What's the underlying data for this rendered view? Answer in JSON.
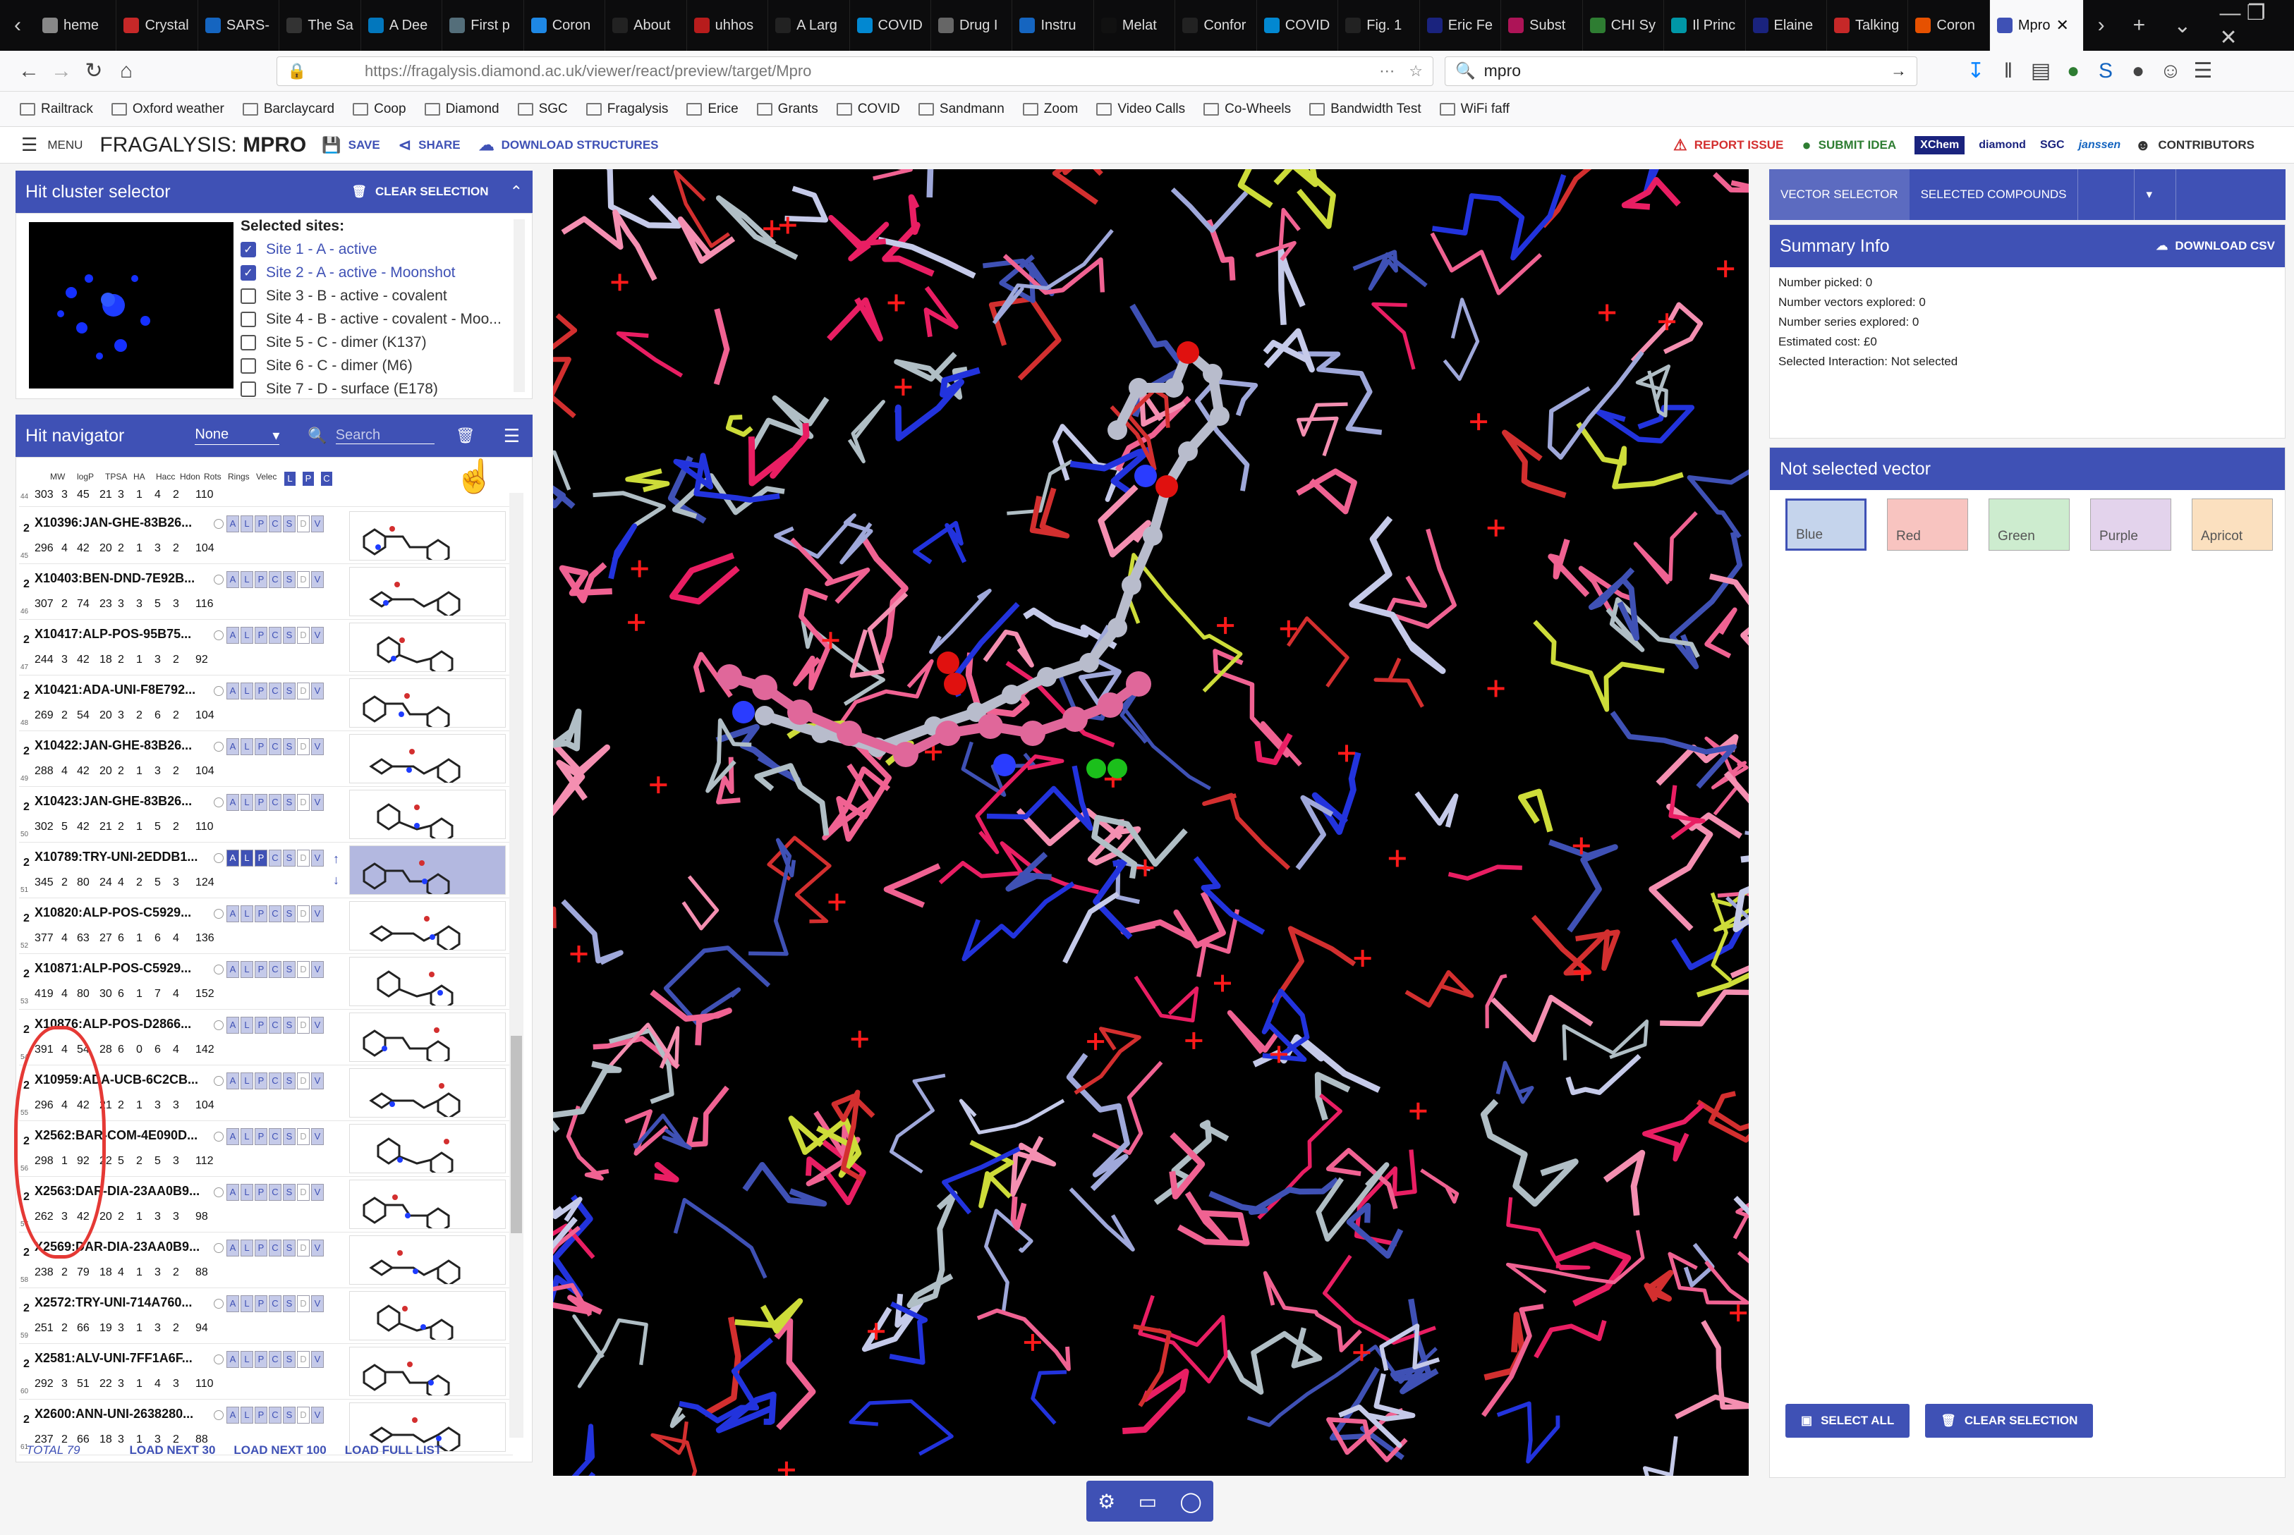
{
  "browser": {
    "tabs": [
      "heme",
      "Crystal",
      "SARS-",
      "The Sa",
      "A Dee",
      "First p",
      "Coron",
      "About",
      "uhhos",
      "A Larg",
      "COVID",
      "Drug I",
      "Instru",
      "Melat",
      "Confor",
      "COVID",
      "Fig. 1",
      "Eric Fe",
      "Subst",
      "CHI Sy",
      "Il Princ",
      "Elaine",
      "Talking",
      "Coron",
      "Mpro"
    ],
    "url": "https://fragalysis.diamond.ac.uk/viewer/react/preview/target/Mpro",
    "search": "mpro",
    "bookmarks": [
      "Railtrack",
      "Oxford weather",
      "Barclaycard",
      "Coop",
      "Diamond",
      "SGC",
      "Fragalysis",
      "Erice",
      "Grants",
      "COVID",
      "Sandmann",
      "Zoom",
      "Video Calls",
      "Co-Wheels",
      "Bandwidth Test",
      "WiFi faff"
    ]
  },
  "header": {
    "menu_label": "MENU",
    "title_prefix": "FRAGALYSIS: ",
    "title_target": "MPRO",
    "save": "SAVE",
    "share": "SHARE",
    "download": "DOWNLOAD STRUCTURES",
    "report": "REPORT ISSUE",
    "submit": "SUBMIT IDEA",
    "logos": [
      "diamond",
      "SGC",
      "janssen"
    ],
    "contributors": "CONTRIBUTORS"
  },
  "cluster": {
    "title": "Hit cluster selector",
    "clear": "CLEAR SELECTION",
    "selected_label": "Selected sites:",
    "sites": [
      {
        "label": "Site 1 - A - active",
        "checked": true
      },
      {
        "label": "Site 2 - A - active - Moonshot",
        "checked": true
      },
      {
        "label": "Site 3 - B - active - covalent",
        "checked": false
      },
      {
        "label": "Site 4 - B - active - covalent - Moo...",
        "checked": false
      },
      {
        "label": "Site 5 - C - dimer (K137)",
        "checked": false
      },
      {
        "label": "Site 6 - C - dimer (M6)",
        "checked": false
      },
      {
        "label": "Site 7 - D - surface (E178)",
        "checked": false
      }
    ]
  },
  "navigator": {
    "title": "Hit navigator",
    "filter": "None",
    "search_placeholder": "Search",
    "columns": [
      "MW",
      "logP",
      "TPSA",
      "HA",
      "Hacc",
      "Hdon",
      "Rots",
      "Rings",
      "Velec"
    ],
    "lpc": [
      "L",
      "P",
      "C"
    ],
    "partial_row": {
      "index": "44",
      "props": [
        "303",
        "3",
        "45",
        "21",
        "3",
        "1",
        "4",
        "2",
        "110"
      ]
    },
    "rows": [
      {
        "index": "45",
        "name": "X10396:JAN-GHE-83B26...",
        "props": [
          "296",
          "4",
          "42",
          "20",
          "2",
          "1",
          "3",
          "2",
          "104"
        ]
      },
      {
        "index": "46",
        "name": "X10403:BEN-DND-7E92B...",
        "props": [
          "307",
          "2",
          "74",
          "23",
          "3",
          "3",
          "5",
          "3",
          "116"
        ]
      },
      {
        "index": "47",
        "name": "X10417:ALP-POS-95B75...",
        "props": [
          "244",
          "3",
          "42",
          "18",
          "2",
          "1",
          "3",
          "2",
          "92"
        ]
      },
      {
        "index": "48",
        "name": "X10421:ADA-UNI-F8E792...",
        "props": [
          "269",
          "2",
          "54",
          "20",
          "3",
          "2",
          "6",
          "2",
          "104"
        ]
      },
      {
        "index": "49",
        "name": "X10422:JAN-GHE-83B26...",
        "props": [
          "288",
          "4",
          "42",
          "20",
          "2",
          "1",
          "3",
          "2",
          "104"
        ]
      },
      {
        "index": "50",
        "name": "X10423:JAN-GHE-83B26...",
        "props": [
          "302",
          "5",
          "42",
          "21",
          "2",
          "1",
          "5",
          "2",
          "110"
        ]
      },
      {
        "index": "51",
        "name": "X10789:TRY-UNI-2EDDB1...",
        "props": [
          "345",
          "2",
          "80",
          "24",
          "4",
          "2",
          "5",
          "3",
          "124"
        ],
        "selected": true
      },
      {
        "index": "52",
        "name": "X10820:ALP-POS-C5929...",
        "props": [
          "377",
          "4",
          "63",
          "27",
          "6",
          "1",
          "6",
          "4",
          "136"
        ]
      },
      {
        "index": "53",
        "name": "X10871:ALP-POS-C5929...",
        "props": [
          "419",
          "4",
          "80",
          "30",
          "6",
          "1",
          "7",
          "4",
          "152"
        ]
      },
      {
        "index": "54",
        "name": "X10876:ALP-POS-D2866...",
        "props": [
          "391",
          "4",
          "54",
          "28",
          "6",
          "0",
          "6",
          "4",
          "142"
        ]
      },
      {
        "index": "55",
        "name": "X10959:ADA-UCB-6C2CB...",
        "props": [
          "296",
          "4",
          "42",
          "21",
          "2",
          "1",
          "3",
          "3",
          "104"
        ]
      },
      {
        "index": "56",
        "name": "X2562:BAR-COM-4E090D...",
        "props": [
          "298",
          "1",
          "92",
          "22",
          "5",
          "2",
          "5",
          "3",
          "112"
        ]
      },
      {
        "index": "57",
        "name": "X2563:DAR-DIA-23AA0B9...",
        "props": [
          "262",
          "3",
          "42",
          "20",
          "2",
          "1",
          "3",
          "3",
          "98"
        ]
      },
      {
        "index": "58",
        "name": "X2569:DAR-DIA-23AA0B9...",
        "props": [
          "238",
          "2",
          "79",
          "18",
          "4",
          "1",
          "3",
          "2",
          "88"
        ]
      },
      {
        "index": "59",
        "name": "X2572:TRY-UNI-714A760...",
        "props": [
          "251",
          "2",
          "66",
          "19",
          "3",
          "1",
          "3",
          "2",
          "94"
        ]
      },
      {
        "index": "60",
        "name": "X2581:ALV-UNI-7FF1A6F...",
        "props": [
          "292",
          "3",
          "51",
          "22",
          "3",
          "1",
          "4",
          "3",
          "110"
        ]
      },
      {
        "index": "61",
        "name": "X2600:ANN-UNI-2638280...",
        "props": [
          "237",
          "2",
          "66",
          "18",
          "3",
          "1",
          "3",
          "2",
          "88"
        ]
      }
    ],
    "total": "TOTAL 79",
    "load_30": "LOAD NEXT 30",
    "load_100": "LOAD NEXT 100",
    "load_full": "LOAD FULL LIST"
  },
  "right": {
    "tab1": "VECTOR SELECTOR",
    "tab2": "SELECTED COMPOUNDS",
    "summary_title": "Summary Info",
    "download_csv": "DOWNLOAD CSV",
    "summary_lines": [
      "Number picked: 0",
      "Number vectors explored: 0",
      "Number series explored: 0",
      "Estimated cost: £0",
      "Selected Interaction: Not selected"
    ],
    "nsv_title": "Not selected vector",
    "colors": [
      "Blue",
      "Red",
      "Green",
      "Purple",
      "Apricot"
    ],
    "select_all": "SELECT ALL",
    "clear_selection": "CLEAR SELECTION"
  },
  "colors": {
    "primary": "#3f51b5",
    "report": "#d32f2f",
    "submit": "#2e7d32",
    "blue_sw": "#c5d4ec",
    "red_sw": "#f8c4c0",
    "green_sw": "#cdeccf",
    "purple_sw": "#e3d3ec",
    "apricot_sw": "#fbe0bf"
  }
}
